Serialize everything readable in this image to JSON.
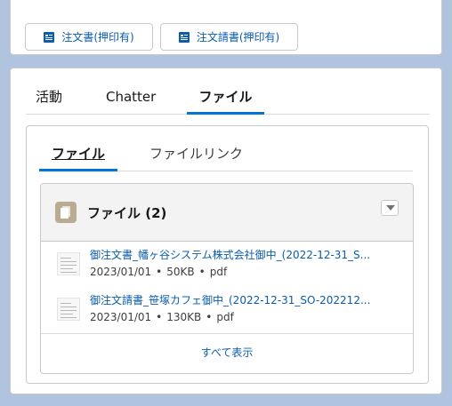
{
  "actions": {
    "order_form_label": "注文書(押印有)",
    "order_request_form_label": "注文請書(押印有)",
    "icon": "document-icon"
  },
  "tabs": [
    {
      "label": "活動"
    },
    {
      "label": "Chatter"
    },
    {
      "label": "ファイル",
      "active": true
    }
  ],
  "subtabs": [
    {
      "label": "ファイル",
      "active": true
    },
    {
      "label": "ファイルリンク"
    }
  ],
  "files_panel": {
    "title": "ファイル (2)",
    "icon": "files-icon",
    "items": [
      {
        "title": "御注文書_幡ヶ谷システム株式会社御中_(2022-12-31_S...",
        "date": "2023/01/01",
        "size": "50KB",
        "type": "pdf"
      },
      {
        "title": "御注文請書_笹塚カフェ御中_(2022-12-31_SO-202212...",
        "date": "2023/01/01",
        "size": "130KB",
        "type": "pdf"
      }
    ],
    "view_all": "すべて表示"
  },
  "colors": {
    "accent": "#0176d3",
    "link": "#0b5cab",
    "background": "#b0c4df"
  }
}
